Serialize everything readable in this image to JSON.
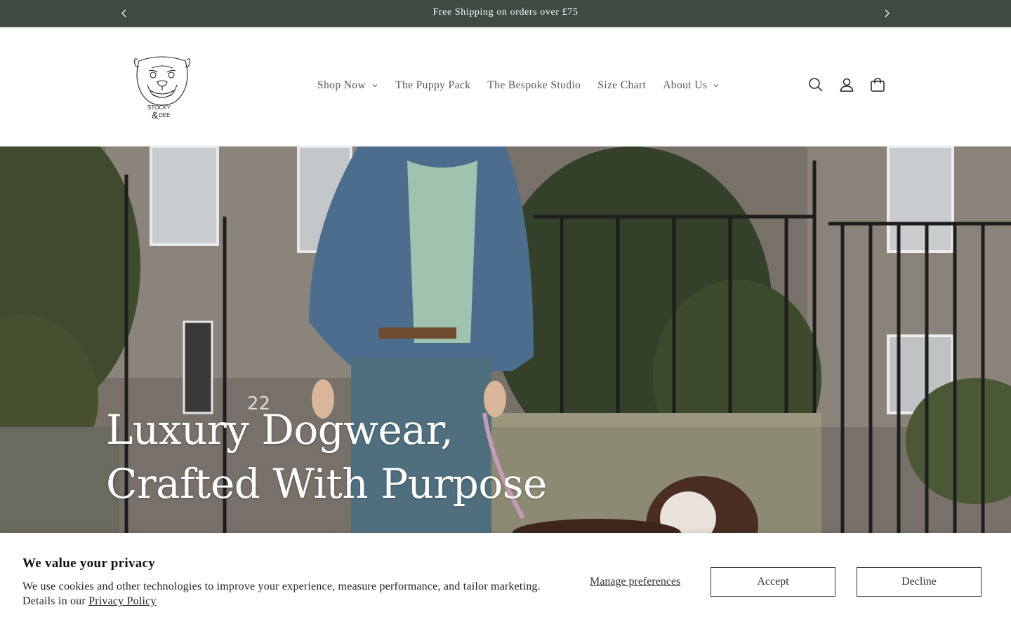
{
  "announcement": {
    "message": "Free Shipping on orders over £75",
    "prev_icon": "chevron-left-icon",
    "next_icon": "chevron-right-icon"
  },
  "header": {
    "logo": {
      "brand_top": "STOCKY",
      "brand_amp": "&",
      "brand_bottom": "DEE"
    },
    "nav": [
      {
        "label": "Shop Now",
        "has_dropdown": true
      },
      {
        "label": "The Puppy Pack",
        "has_dropdown": false
      },
      {
        "label": "The Bespoke Studio",
        "has_dropdown": false
      },
      {
        "label": "Size Chart",
        "has_dropdown": false
      },
      {
        "label": "About Us",
        "has_dropdown": true
      }
    ],
    "icons": [
      "search-icon",
      "account-icon",
      "cart-icon"
    ]
  },
  "hero": {
    "title_line1": "Luxury Dogwear,",
    "title_line2": "Crafted With Purpose",
    "house_number": "22"
  },
  "cookie_banner": {
    "title": "We value your privacy",
    "text": "We use cookies and other technologies to improve your experience, measure performance, and tailor marketing. Details in our ",
    "privacy_link": "Privacy Policy",
    "manage_label": "Manage preferences",
    "accept_label": "Accept",
    "decline_label": "Decline"
  },
  "colors": {
    "announcement_bg": "#3f4a42",
    "text_dark": "#121212",
    "nav_text": "#555555"
  }
}
